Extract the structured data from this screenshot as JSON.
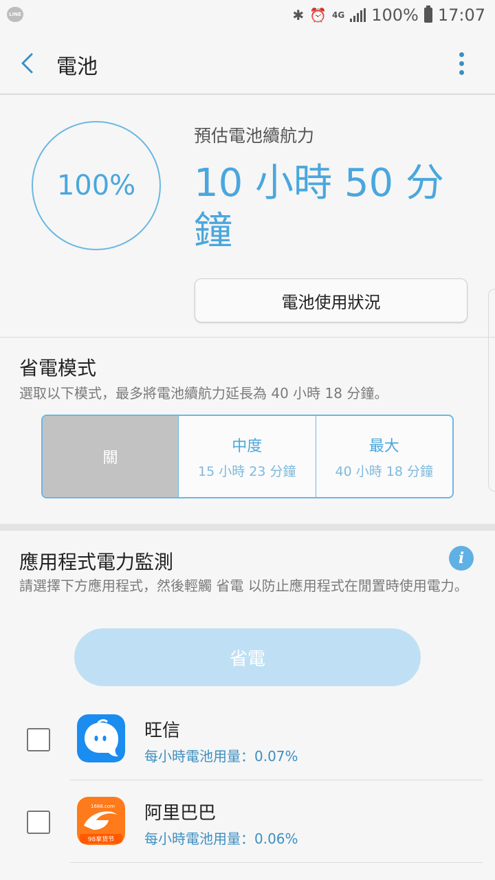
{
  "status_bar": {
    "left_icon": "line-icon",
    "left_icon_text": "LINE",
    "network": "4G",
    "battery_percent": "100%",
    "time": "17:07"
  },
  "header": {
    "title": "電池"
  },
  "battery": {
    "level": "100%",
    "estimate_label": "預估電池續航力",
    "estimate_value": "10 小時 50 分鐘",
    "usage_button": "電池使用狀況"
  },
  "power_saving": {
    "title": "省電模式",
    "description": "選取以下模式，最多將電池續航力延長為 40 小時 18 分鐘。",
    "modes": [
      {
        "name": "關",
        "time": "",
        "selected": true
      },
      {
        "name": "中度",
        "time": "15 小時 23 分鐘",
        "selected": false
      },
      {
        "name": "最大",
        "time": "40 小時 18 分鐘",
        "selected": false
      }
    ]
  },
  "app_monitor": {
    "title": "應用程式電力監測",
    "info_icon": "i",
    "description": "請選擇下方應用程式，然後輕觸 省電 以防止應用程式在閒置時使用電力。",
    "save_button": "省電",
    "apps": [
      {
        "name": "旺信",
        "usage": "每小時電池用量：0.07%",
        "icon": "wangxin-app-icon",
        "checked": false
      },
      {
        "name": "阿里巴巴",
        "usage": "每小時電池用量：0.06%",
        "icon": "alibaba-app-icon",
        "icon_text": "1688.com",
        "icon_subtext": "98拿货节",
        "checked": false
      }
    ]
  },
  "colors": {
    "accent": "#4aa7dd",
    "selected_mode": "#c2c2c2",
    "save_button": "#bfe0f4"
  }
}
